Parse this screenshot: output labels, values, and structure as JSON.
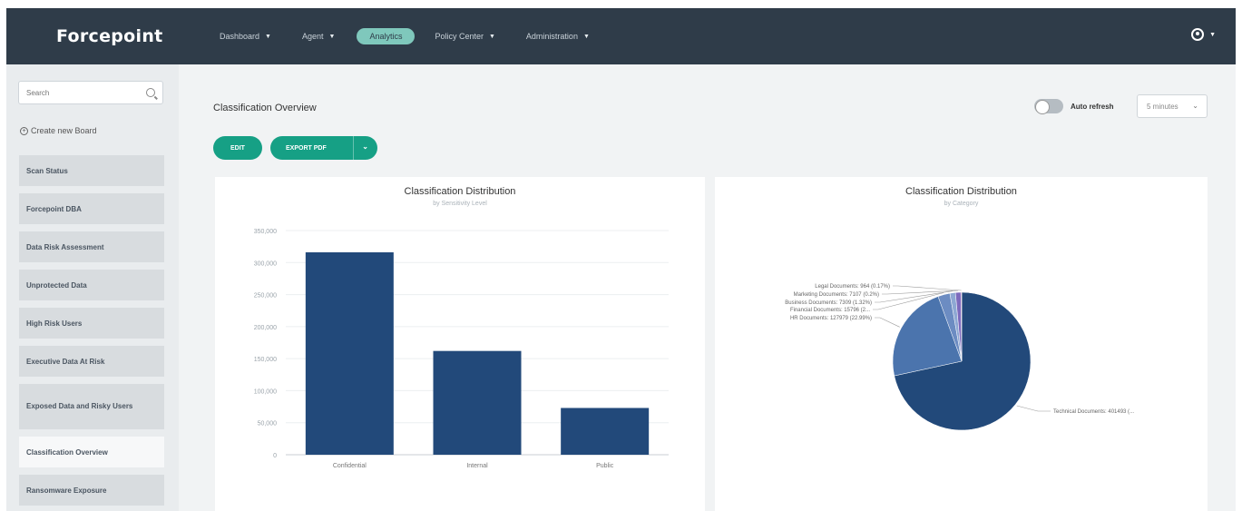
{
  "header": {
    "logo": "Forcepoint",
    "nav": [
      {
        "label": "Dashboard",
        "caret": "▼"
      },
      {
        "label": "Agent",
        "caret": "▼"
      },
      {
        "label": "Analytics",
        "active": true
      },
      {
        "label": "Policy Center",
        "caret": "▼"
      },
      {
        "label": "Administration",
        "caret": "▼"
      }
    ]
  },
  "sidebar": {
    "search_placeholder": "Search",
    "create_label": "Create new Board",
    "items": [
      {
        "label": "Scan Status"
      },
      {
        "label": "Forcepoint DBA"
      },
      {
        "label": "Data Risk Assessment"
      },
      {
        "label": "Unprotected Data"
      },
      {
        "label": "High Risk Users"
      },
      {
        "label": "Executive Data At Risk"
      },
      {
        "label": "Exposed Data and Risky Users"
      },
      {
        "label": "Classification Overview",
        "active": true
      },
      {
        "label": "Ransomware Exposure"
      }
    ]
  },
  "main": {
    "title": "Classification Overview",
    "edit_label": "EDIT",
    "export_label": "EXPORT PDF",
    "auto_refresh_label": "Auto refresh",
    "auto_refresh_on": false,
    "interval_value": "5 minutes"
  },
  "colors": {
    "bar": "#22497a",
    "pie": [
      "#22497a",
      "#4b74ad",
      "#6c8cc2",
      "#8ea8d3",
      "#7d6bbd",
      "#b05fb6"
    ]
  },
  "chart_data": [
    {
      "type": "bar",
      "title": "Classification Distribution",
      "subtitle": "by Sensitivity Level",
      "categories": [
        "Confidential",
        "Internal",
        "Public"
      ],
      "values": [
        316000,
        162000,
        73000
      ],
      "ylim": [
        0,
        350000
      ],
      "yticks": [
        0,
        50000,
        100000,
        150000,
        200000,
        250000,
        300000,
        350000
      ],
      "ytick_labels": [
        "0",
        "50,000",
        "100,000",
        "150,000",
        "200,000",
        "250,000",
        "300,000",
        "350,000"
      ],
      "grid": true
    },
    {
      "type": "pie",
      "title": "Classification Distribution",
      "subtitle": "by Category",
      "labels": [
        "Technical Documents",
        "HR Documents",
        "Financial Documents",
        "Business Documents",
        "Marketing Documents",
        "Legal Documents"
      ],
      "values": [
        401493,
        127979,
        15796,
        7309,
        7107,
        964
      ],
      "slice_labels": [
        "Technical Documents: 401493 (...",
        "HR Documents: 127979 (22.99%)",
        "Financial Documents: 15796 (2...",
        "Business Documents: 7309 (1.32%)",
        "Marketing Documents: 7107 (0.2%)",
        "Legal Documents: 964 (0.17%)"
      ]
    }
  ]
}
